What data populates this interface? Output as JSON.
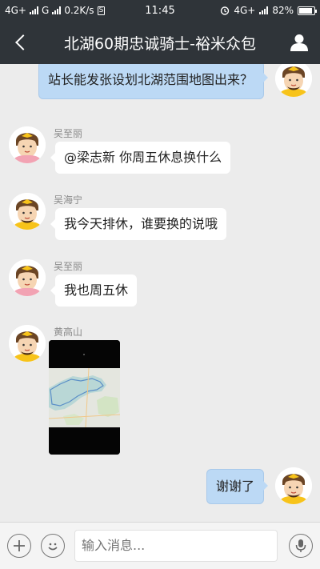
{
  "status_bar": {
    "network_1": "4G+",
    "network_2": "G",
    "speed": "0.2K/s",
    "s_badge": "S",
    "time": "11:45",
    "network_3": "4G+",
    "battery": "82%"
  },
  "header": {
    "title": "北湖60期忠诚骑士-裕米众包",
    "back_icon": "back-chevron-icon",
    "profile_icon": "person-icon",
    "bg_color": "#2f3439"
  },
  "messages": [
    {
      "side": "right",
      "text": "站长能发张设划北湖范围地图出来？"
    },
    {
      "side": "left",
      "sender": "吴至丽",
      "text": "@梁志新 你周五休息换什么"
    },
    {
      "side": "left",
      "sender": "吴海宁",
      "text": "我今天排休，谁要换的说哦"
    },
    {
      "side": "left",
      "sender": "吴至丽",
      "text": "我也周五休"
    },
    {
      "side": "left",
      "sender": "黄高山",
      "type": "image",
      "image_desc": "map-image"
    },
    {
      "side": "right",
      "text": "谢谢了"
    }
  ],
  "input_bar": {
    "placeholder": "输入消息...",
    "add_icon": "plus-icon",
    "emoji_icon": "emoji-icon",
    "voice_icon": "microphone-icon"
  },
  "colors": {
    "bubble_self": "#bcd9f5",
    "bubble_other": "#ffffff",
    "chat_bg": "#ececec"
  }
}
